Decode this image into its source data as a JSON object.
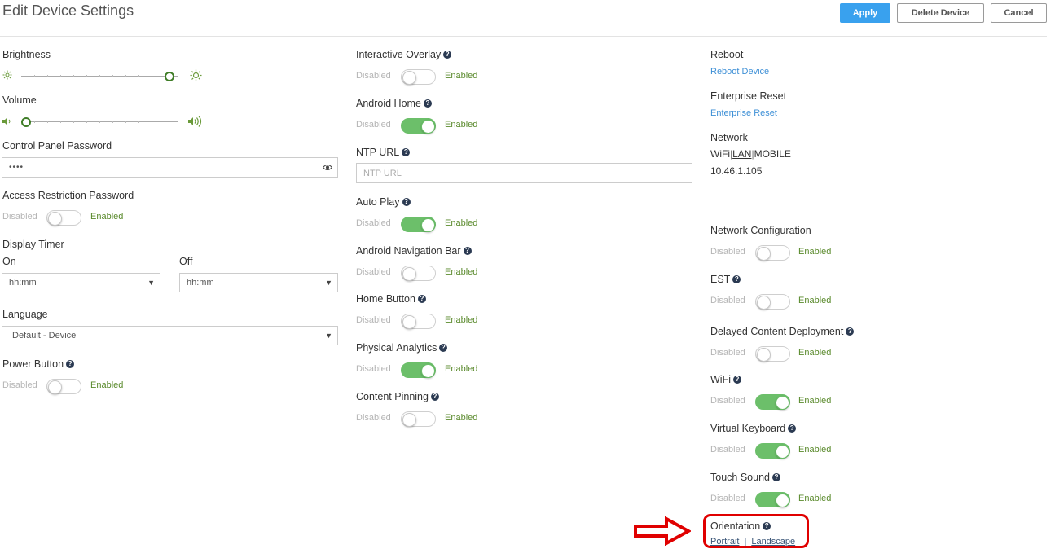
{
  "header": {
    "title": "Edit Device Settings",
    "apply": "Apply",
    "delete": "Delete Device",
    "cancel": "Cancel"
  },
  "toggle_labels": {
    "disabled": "Disabled",
    "enabled": "Enabled"
  },
  "col1": {
    "brightness": {
      "label": "Brightness",
      "value_fraction": 0.98
    },
    "volume": {
      "label": "Volume",
      "value_fraction": 0.0
    },
    "control_panel_password": {
      "label": "Control Panel Password",
      "value": "••••"
    },
    "access_restriction_password": {
      "label": "Access Restriction Password",
      "enabled": false
    },
    "display_timer": {
      "label": "Display Timer",
      "on_label": "On",
      "on_value": "hh:mm",
      "off_label": "Off",
      "off_value": "hh:mm"
    },
    "language": {
      "label": "Language",
      "value": "Default - Device"
    },
    "power_button": {
      "label": "Power Button",
      "enabled": false
    }
  },
  "col2": {
    "interactive_overlay": {
      "label": "Interactive Overlay",
      "enabled": false
    },
    "android_home": {
      "label": "Android Home",
      "enabled": true
    },
    "ntp_url": {
      "label": "NTP URL",
      "placeholder": "NTP URL"
    },
    "auto_play": {
      "label": "Auto Play",
      "enabled": true
    },
    "android_nav_bar": {
      "label": "Android Navigation Bar",
      "enabled": false
    },
    "home_button": {
      "label": "Home Button",
      "enabled": false
    },
    "physical_analytics": {
      "label": "Physical Analytics",
      "enabled": true
    },
    "content_pinning": {
      "label": "Content Pinning",
      "enabled": false
    }
  },
  "col3": {
    "reboot": {
      "label": "Reboot",
      "link": "Reboot Device"
    },
    "enterprise_reset": {
      "label": "Enterprise Reset",
      "link": "Enterprise Reset"
    },
    "network": {
      "label": "Network",
      "wifi": "WiFi",
      "sep1": "|",
      "lan": "LAN",
      "sep2": "|",
      "mobile": "MOBILE",
      "ip": "10.46.1.105"
    },
    "network_configuration": {
      "label": "Network Configuration",
      "enabled": false
    },
    "est": {
      "label": "EST",
      "enabled": false
    },
    "delayed_content": {
      "label": "Delayed Content Deployment",
      "enabled": false
    },
    "wifi": {
      "label": "WiFi",
      "enabled": true
    },
    "virtual_keyboard": {
      "label": "Virtual Keyboard",
      "enabled": true
    },
    "touch_sound": {
      "label": "Touch Sound",
      "enabled": true
    },
    "orientation": {
      "label": "Orientation",
      "portrait": "Portrait",
      "sep": "|",
      "landscape": "Landscape"
    }
  },
  "colors": {
    "primary": "#39a1ee",
    "toggle_on": "#6cbf6a",
    "enabled_text": "#5a8a2c",
    "link": "#3d8fd6",
    "highlight": "#e00000"
  }
}
